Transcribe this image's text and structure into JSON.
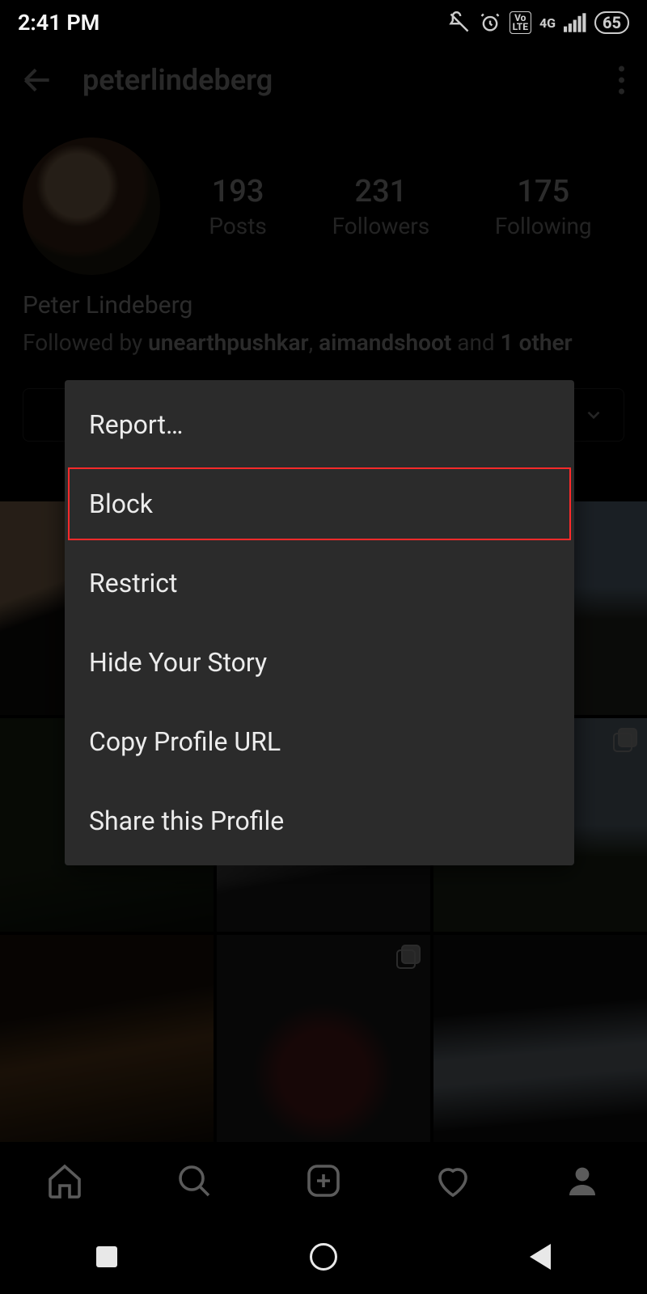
{
  "status": {
    "time": "2:41 PM",
    "network_label": "4G",
    "battery_percent": "65",
    "volte": "Vo\nLTE"
  },
  "header": {
    "username": "peterlindeberg"
  },
  "profile": {
    "stats": {
      "posts_num": "193",
      "posts_lab": "Posts",
      "followers_num": "231",
      "followers_lab": "Followers",
      "following_num": "175",
      "following_lab": "Following"
    },
    "display_name": "Peter Lindeberg",
    "followed_prefix": "Followed by ",
    "followed_1": "unearthpushkar",
    "followed_sep": ", ",
    "followed_2": "aimandshoot",
    "followed_and": " and ",
    "followed_3": "1 other"
  },
  "menu": {
    "report": "Report…",
    "block": "Block",
    "restrict": "Restrict",
    "hide_story": "Hide Your Story",
    "copy_url": "Copy Profile URL",
    "share": "Share this Profile"
  }
}
